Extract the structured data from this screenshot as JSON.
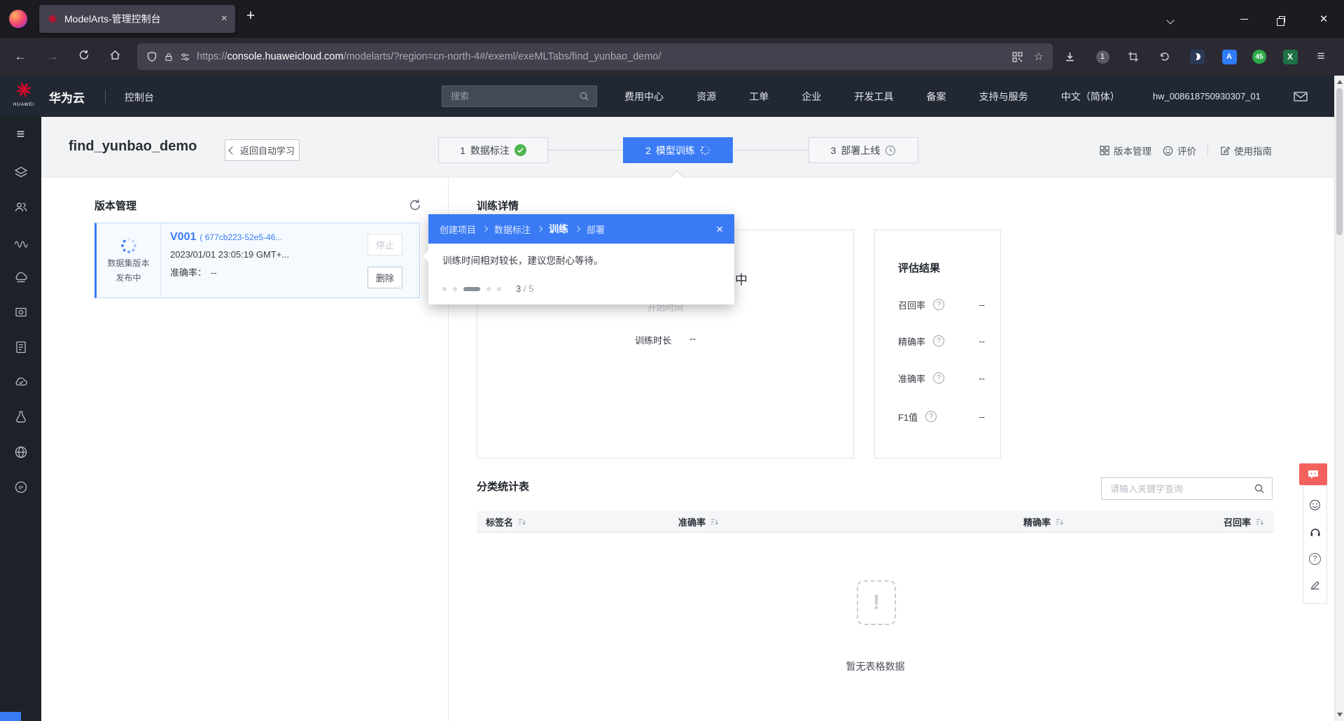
{
  "colors": {
    "primary_blue": "#3a7bf5",
    "success_green": "#4db64d",
    "brand_red": "#cf0a2c",
    "feedback_red": "#f3625c"
  },
  "glyphs": {
    "back": "←",
    "forward": "→",
    "plus": "+",
    "close": "×",
    "hamburger": "≡",
    "star": "☆",
    "exclaim": "!",
    "question": "?"
  },
  "browser": {
    "tab_title": "ModelArts-管理控制台",
    "url_prefix": "https://",
    "url_domain": "console.huaweicloud.com",
    "url_path": "/modelarts/?region=cn-north-4#/exeml/exeMLTabs/find_yunbao_demo/",
    "notification_badge": "1",
    "translate_ext_label": "A",
    "counter_ext_label": "45",
    "excel_ext_label": "X"
  },
  "topnav": {
    "logo_text": "HUAWEI",
    "brand": "华为云",
    "console": "控制台",
    "search_placeholder": "搜索",
    "links": [
      "费用中心",
      "资源",
      "工单",
      "企业",
      "开发工具",
      "备案",
      "支持与服务",
      "中文（简体）"
    ],
    "account": "hw_008618750930307_01"
  },
  "sidebar": {
    "ip_label": "IP"
  },
  "page": {
    "title": "find_yunbao_demo",
    "back_button": "返回自动学习",
    "steps": [
      {
        "num": "1",
        "label": "数据标注"
      },
      {
        "num": "2",
        "label": "模型训练"
      },
      {
        "num": "3",
        "label": "部署上线"
      }
    ],
    "actions": {
      "version_mgmt": "版本管理",
      "rate": "评价",
      "guide": "使用指南"
    }
  },
  "version_panel": {
    "title": "版本管理",
    "card": {
      "status_line1": "数据集版本",
      "status_line2": "发布中",
      "name": "V001",
      "id": "( 677cb223-52e5-46...",
      "time": "2023/01/01 23:05:19 GMT+...",
      "accuracy_label": "准确率：",
      "accuracy_value": "--",
      "stop_button": "停止",
      "delete_button": "删除"
    }
  },
  "training": {
    "title": "训练详情",
    "status": "运行中",
    "pending_label": "开始时间",
    "duration_label": "训练时长",
    "duration_value": "--",
    "evaluation": {
      "title": "评估结果",
      "rows": [
        {
          "label": "召回率",
          "value": "--"
        },
        {
          "label": "精确率",
          "value": "--"
        },
        {
          "label": "准确率",
          "value": "--"
        },
        {
          "label": "F1值",
          "value": "--"
        }
      ]
    }
  },
  "guide_popover": {
    "steps": [
      "创建项目",
      "数据标注",
      "训练",
      "部署"
    ],
    "message": "训练时间相对较长，建议您耐心等待。",
    "progress_current": "3",
    "progress_rest": " / 5"
  },
  "stats_table": {
    "title": "分类统计表",
    "search_placeholder": "请输入关键字查询",
    "columns": [
      "标签名",
      "准确率",
      "精确率",
      "召回率"
    ],
    "empty_text": "暂无表格数据"
  }
}
